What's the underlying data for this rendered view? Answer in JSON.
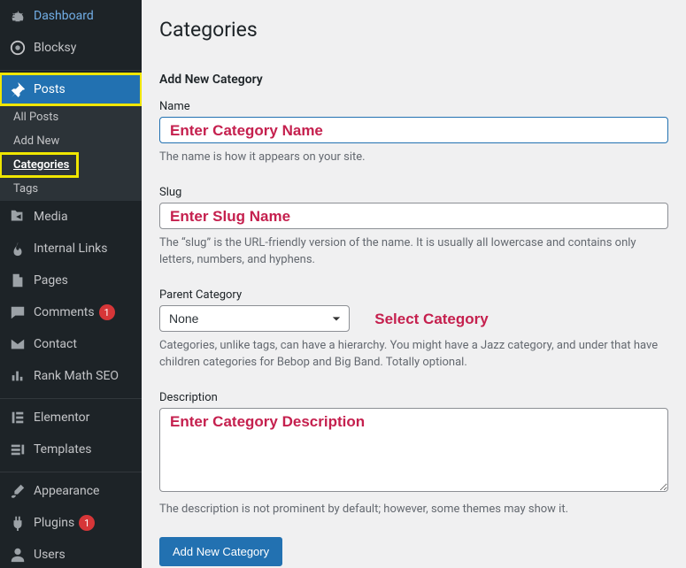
{
  "sidebar": {
    "items": [
      {
        "label": "Dashboard",
        "icon": "dashboard"
      },
      {
        "label": "Blocksy",
        "icon": "blocksy"
      },
      {
        "label": "Posts",
        "icon": "pin",
        "current": true,
        "highlight": true,
        "submenu": [
          {
            "label": "All Posts"
          },
          {
            "label": "Add New"
          },
          {
            "label": "Categories",
            "current": true,
            "highlight": true
          },
          {
            "label": "Tags"
          }
        ]
      },
      {
        "label": "Media",
        "icon": "media"
      },
      {
        "label": "Internal Links",
        "icon": "flame"
      },
      {
        "label": "Pages",
        "icon": "page"
      },
      {
        "label": "Comments",
        "icon": "comment",
        "badge": "1"
      },
      {
        "label": "Contact",
        "icon": "envelope"
      },
      {
        "label": "Rank Math SEO",
        "icon": "chart"
      },
      {
        "label": "Elementor",
        "icon": "elementor"
      },
      {
        "label": "Templates",
        "icon": "templates"
      },
      {
        "label": "Appearance",
        "icon": "brush"
      },
      {
        "label": "Plugins",
        "icon": "plug",
        "badge": "1"
      },
      {
        "label": "Users",
        "icon": "user"
      }
    ],
    "separators_after_index": [
      1,
      8,
      10
    ]
  },
  "page": {
    "title": "Categories",
    "add_heading": "Add New Category",
    "fields": {
      "name": {
        "label": "Name",
        "hint": "Enter Category Name",
        "desc": "The name is how it appears on your site."
      },
      "slug": {
        "label": "Slug",
        "hint": "Enter Slug Name",
        "desc": "The “slug” is the URL-friendly version of the name. It is usually all lowercase and contains only letters, numbers, and hyphens."
      },
      "parent": {
        "label": "Parent Category",
        "selected": "None",
        "hint": "Select Category",
        "desc": "Categories, unlike tags, can have a hierarchy. You might have a Jazz category, and under that have children categories for Bebop and Big Band. Totally optional."
      },
      "description": {
        "label": "Description",
        "hint": "Enter Category Description",
        "desc": "The description is not prominent by default; however, some themes may show it."
      }
    },
    "submit_label": "Add New Category"
  },
  "icons_svg": {
    "dashboard": "<path d='M3.76 16h12.48A7 7 0 1 0 3.76 16zM10 4v3h1V4zm5.66 2.34l-2.12 2.12.7.7 2.13-2.12zM17 11h-3v1h3zM4.34 6.34l2.12 2.12-.7.7L3.63 7zM3 11h3v1H3zm7-1a2 2 0 0 0-2 2c0 .6.27 1.13.7 1.5L7 17h6l-1.7-3.5c.43-.37.7-.9.7-1.5a2 2 0 0 0-2-2z'/>",
    "blocksy": "<circle cx='10' cy='10' r='8' fill='none' stroke='currentColor' stroke-width='2'/><circle cx='10' cy='10' r='3'/>",
    "pin": "<path d='M10.44 1.1l8.47 8.46-1.42 1.42-.7-.7-4.25 4.24.35 2.83L10.77 20l-4.24-4.24L2 20l4.24-4.53L2 11.23l2.83-2.12 2.83.35 4.24-4.24-.7-.7z'/>",
    "media": "<path d='M2 2h5l2 2h7v2H2zm0 3h14v10H2zm12 8V7l-6 3z'/>",
    "flame": "<path d='M10 2c1 3-2 4-2 7 0 2 1 3 2 3s2-1 2-3c2 1 3 3 3 5 0 3-2 5-5 5s-5-2-5-5c0-5 5-7 5-12z'/>",
    "page": "<path d='M4 2h8l4 4v12H4zm8 0v4h4'/>",
    "comment": "<path d='M2 3h16v11H7l-5 4z'/>",
    "envelope": "<path d='M2 4h16v12H2zm0 0l8 6 8-6'/>",
    "chart": "<path d='M3 16h3V9H3zm5 0h3V4H8zm5 0h3v-5h-3z'/>",
    "elementor": "<rect x='3' y='3' width='3' height='14'/><rect x='8' y='3' width='9' height='3'/><rect x='8' y='8.5' width='9' height='3'/><rect x='8' y='14' width='9' height='3'/>",
    "templates": "<path d='M2 4h11v3H2zm13 0h3v12h-3zM2 9h11v3H2zm0 5h11v3H2z'/>",
    "brush": "<path d='M14 2l4 4-8 8H6v-4zM2 17c2-3 6-1 6-1l-2 2c-1 1-4 1-4-1z'/>",
    "plug": "<path d='M7 2v5H5v5a5 5 0 0 0 4 4.9V20h2v-3.1A5 5 0 0 0 15 12V7h-2V2h-2v5H9V2z'/>",
    "user": "<circle cx='10' cy='6' r='4'/><path d='M2 18c0-4 4-6 8-6s8 2 8 6v1H2z'/>"
  }
}
